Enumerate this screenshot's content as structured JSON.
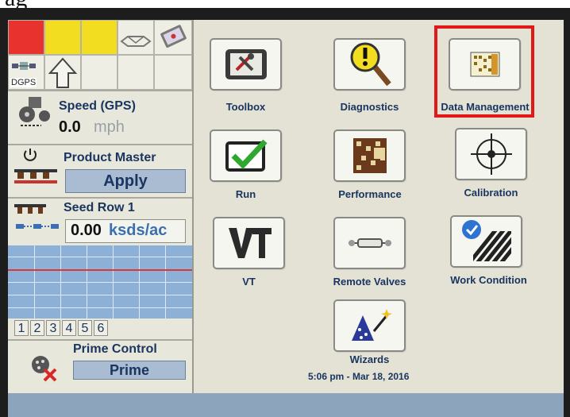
{
  "page_header_fragment": "ag",
  "status_panel": {
    "gps_source": "DGPS",
    "speed": {
      "label": "Speed (GPS)",
      "value": "0.0",
      "unit": "mph"
    },
    "product_master": {
      "label": "Product Master",
      "button": "Apply"
    },
    "seed_row": {
      "label": "Seed Row 1",
      "value": "0.00",
      "unit": "ksds/ac"
    },
    "rows": [
      "1",
      "2",
      "3",
      "4",
      "5",
      "6"
    ],
    "prime_control": {
      "label": "Prime Control",
      "button": "Prime"
    }
  },
  "menu": {
    "items": [
      {
        "label": "Toolbox",
        "icon": "toolbox-icon"
      },
      {
        "label": "Diagnostics",
        "icon": "diagnostics-icon"
      },
      {
        "label": "Data Management",
        "icon": "data-management-icon"
      },
      {
        "label": "Run",
        "icon": "run-icon"
      },
      {
        "label": "Performance",
        "icon": "performance-icon"
      },
      {
        "label": "Calibration",
        "icon": "calibration-icon"
      },
      {
        "label": "VT",
        "icon": "vt-icon"
      },
      {
        "label": "Remote Valves",
        "icon": "remote-valves-icon"
      },
      {
        "label": "Work Condition",
        "icon": "work-condition-icon"
      },
      {
        "label": "Wizards",
        "icon": "wizards-icon"
      }
    ],
    "selected": "Data Management"
  },
  "datetime": "5:06 pm - Mar 18, 2016",
  "colors": {
    "highlight": "#e11818",
    "status_red": "#e8322e",
    "status_yellow": "#f2dd21",
    "text_blue": "#1a3560"
  }
}
